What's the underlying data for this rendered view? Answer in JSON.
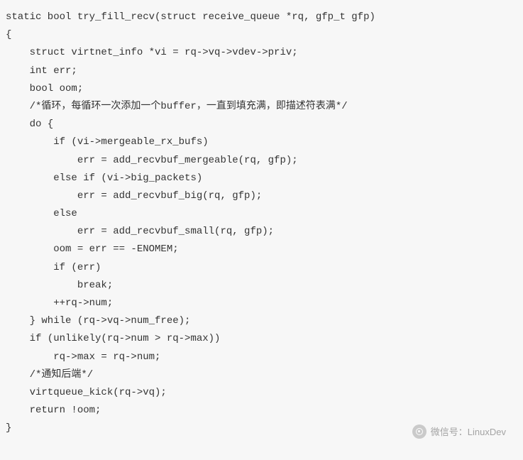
{
  "code": {
    "lines": [
      "static bool try_fill_recv(struct receive_queue *rq, gfp_t gfp)",
      "{",
      "    struct virtnet_info *vi = rq->vq->vdev->priv;",
      "    int err;",
      "    bool oom;",
      "    /*循环，每循环一次添加一个buffer，一直到填充满，即描述符表满*/",
      "    do {",
      "        if (vi->mergeable_rx_bufs)",
      "            err = add_recvbuf_mergeable(rq, gfp);",
      "        else if (vi->big_packets)",
      "            err = add_recvbuf_big(rq, gfp);",
      "        else",
      "            err = add_recvbuf_small(rq, gfp);",
      "        oom = err == -ENOMEM;",
      "        if (err)",
      "            break;",
      "        ++rq->num;",
      "    } while (rq->vq->num_free);",
      "    if (unlikely(rq->num > rq->max))",
      "        rq->max = rq->num;",
      "    /*通知后端*/",
      "    virtqueue_kick(rq->vq);",
      "    return !oom;",
      "}"
    ]
  },
  "watermark": {
    "label": "微信号：LinuxDev"
  }
}
